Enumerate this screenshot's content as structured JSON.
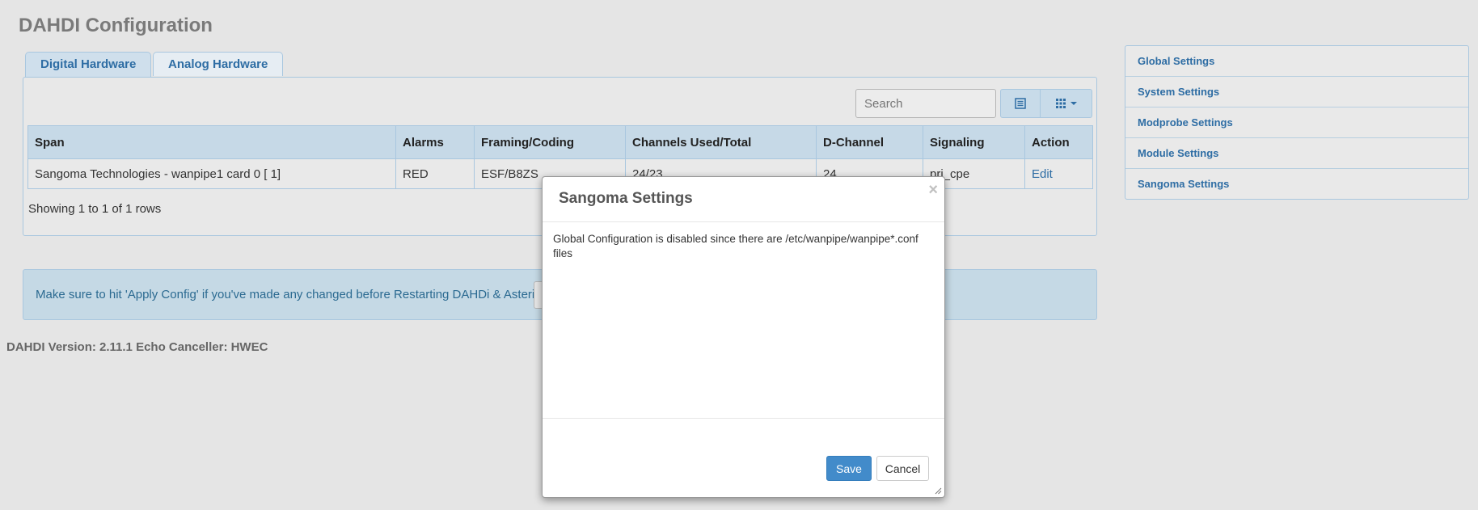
{
  "page": {
    "title": "DAHDI Configuration"
  },
  "tabs": [
    {
      "label": "Digital Hardware",
      "active": true
    },
    {
      "label": "Analog Hardware",
      "active": false
    }
  ],
  "toolbar": {
    "search_placeholder": "Search",
    "view_icon": "list-icon",
    "columns_icon": "grid-dropdown-icon"
  },
  "table": {
    "headers": [
      "Span",
      "Alarms",
      "Framing/Coding",
      "Channels Used/Total",
      "D-Channel",
      "Signaling",
      "Action"
    ],
    "rows": [
      [
        "Sangoma Technologies - wanpipe1 card 0 [ 1]",
        "RED",
        "ESF/B8ZS",
        "24/23",
        "24",
        "pri_cpe",
        "Edit"
      ]
    ],
    "footer": "Showing 1 to 1 of 1 rows"
  },
  "notice": {
    "text": "Make sure to hit 'Apply Config' if you've made any changed before Restarting DAHDi & Asterisk"
  },
  "version": {
    "text": "DAHDI Version: 2.11.1 Echo Canceller: HWEC"
  },
  "sidebar": {
    "items": [
      {
        "label": "Global Settings"
      },
      {
        "label": "System Settings"
      },
      {
        "label": "Modprobe Settings"
      },
      {
        "label": "Module Settings"
      },
      {
        "label": "Sangoma Settings"
      }
    ]
  },
  "modal": {
    "title": "Sangoma Settings",
    "close_symbol": "×",
    "body": "Global Configuration is disabled since there are /etc/wanpipe/wanpipe*.conf files",
    "save_label": "Save",
    "cancel_label": "Cancel"
  },
  "colors": {
    "accent": "#2e6da4",
    "primary_button": "#428bca",
    "table_header": "#c6d9e7",
    "notice_bg": "#c5d9e5"
  }
}
